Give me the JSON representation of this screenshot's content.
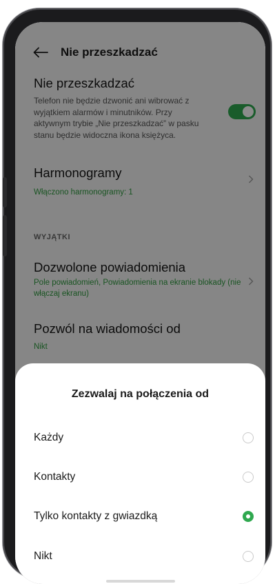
{
  "header": {
    "title": "Nie przeszkadzać"
  },
  "dnd": {
    "title": "Nie przeszkadzać",
    "description": "Telefon nie będzie dzwonić ani wibrować z wyjątkiem alarmów i minutników. Przy aktywnym trybie „Nie przeszkadzać” w pasku stanu będzie widoczna ikona księżyca.",
    "enabled": true
  },
  "schedules": {
    "title": "Harmonogramy",
    "status": "Włączono harmonogramy: 1"
  },
  "exceptions": {
    "section_label": "WYJĄTKI"
  },
  "allowed_notifications": {
    "title": "Dozwolone powiadomienia",
    "status": "Pole powiadomień, Powiadomienia na ekranie blokady (nie włączaj ekranu)"
  },
  "messages_from": {
    "title": "Pozwól na wiadomości od",
    "status": "Nikt"
  },
  "sheet": {
    "title": "Zezwalaj na połączenia od",
    "options": [
      {
        "label": "Każdy",
        "selected": false
      },
      {
        "label": "Kontakty",
        "selected": false
      },
      {
        "label": "Tylko kontakty z gwiazdką",
        "selected": true
      },
      {
        "label": "Nikt",
        "selected": false
      }
    ]
  },
  "colors": {
    "accent": "#2fa84f",
    "accent_text": "#2f9a3f"
  }
}
